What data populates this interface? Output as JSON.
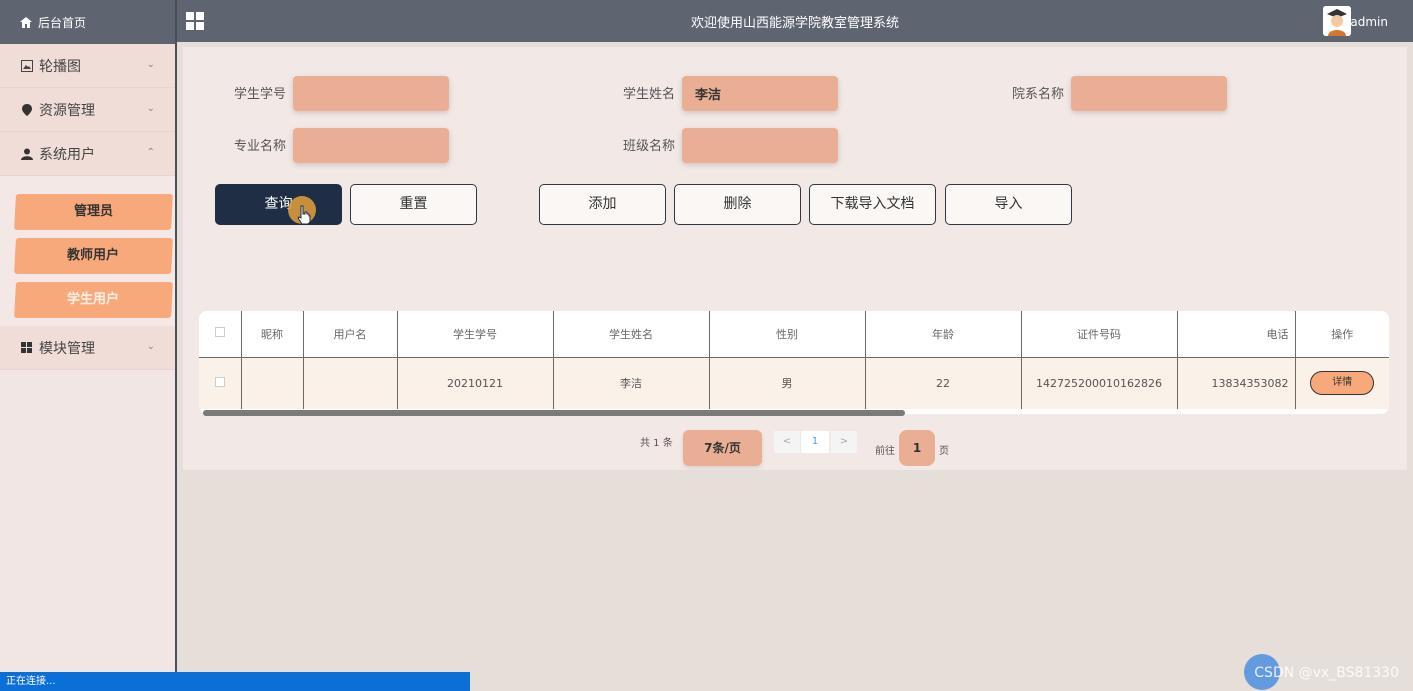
{
  "sidebar": {
    "brand_label": "后台首页",
    "menu": [
      {
        "label": "轮播图",
        "icon": "image-icon"
      },
      {
        "label": "资源管理",
        "icon": "pin-icon"
      },
      {
        "label": "系统用户",
        "icon": "user-icon"
      },
      {
        "label": "模块管理",
        "icon": "grid-icon"
      }
    ],
    "submenu": [
      "管理员",
      "教师用户",
      "学生用户"
    ],
    "active_submenu": "学生用户"
  },
  "header": {
    "title": "欢迎使用山西能源学院教室管理系统",
    "username": "admin"
  },
  "search": {
    "student_no": {
      "label": "学生学号",
      "value": ""
    },
    "student_name": {
      "label": "学生姓名",
      "value": "李洁"
    },
    "department": {
      "label": "院系名称",
      "value": ""
    },
    "major": {
      "label": "专业名称",
      "value": ""
    },
    "class_name": {
      "label": "班级名称",
      "value": ""
    }
  },
  "buttons": {
    "query": "查询",
    "reset": "重置",
    "add": "添加",
    "delete": "删除",
    "download": "下载导入文档",
    "import": "导入"
  },
  "table": {
    "columns": [
      "昵称",
      "用户名",
      "学生学号",
      "学生姓名",
      "性别",
      "年龄",
      "证件号码",
      "电话",
      "操作"
    ],
    "rows": [
      {
        "nickname": "",
        "username": "",
        "student_no": "20210121",
        "student_name": "李洁",
        "gender": "男",
        "age": "22",
        "id_number": "142725200010162826",
        "phone": "13834353082",
        "action": "详情"
      }
    ]
  },
  "pagination": {
    "total": "共 1 条",
    "page_size": "7条/页",
    "prev": "<",
    "current": "1",
    "next": ">",
    "goto": "前往",
    "goto_value": "1",
    "page_suffix": "页"
  },
  "statusbar": {
    "text": "正在连接..."
  },
  "watermark": "CSDN @vx_BS81330",
  "colors": {
    "accent": "#f8a97c",
    "header": "#5f6570",
    "primary_button": "#1f2d45",
    "input_fill": "#e9ae94"
  }
}
